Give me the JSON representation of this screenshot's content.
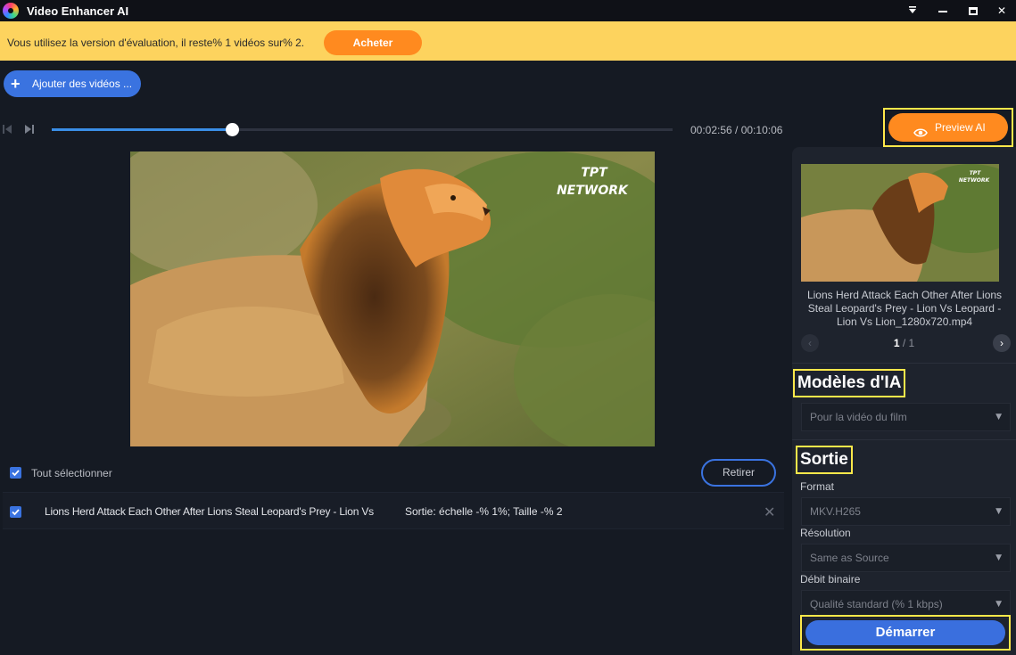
{
  "app": {
    "title": "Video Enhancer AI",
    "icons": [
      "app-logo-icon",
      "dropdown-menu-icon",
      "minimize-icon",
      "maximize-icon",
      "close-icon"
    ]
  },
  "banner": {
    "text": "Vous utilisez la version d'évaluation, il reste% 1 vidéos sur% 2.",
    "buy_label": "Acheter"
  },
  "toolbar": {
    "add_videos_label": "Ajouter des vidéos ..."
  },
  "player": {
    "time": "00:02:56 / 00:10:06",
    "progress": 0.29,
    "watermark": "TPT NETWORK",
    "preview_label": "Preview AI"
  },
  "list": {
    "select_all_label": "Tout sélectionner",
    "remove_label": "Retirer",
    "rows": [
      {
        "name": "Lions Herd Attack Each Other After Lions Steal Leopard's Prey - Lion Vs",
        "output": "Sortie: échelle -% 1%; Taille -% 2"
      }
    ]
  },
  "panel": {
    "thumbnail_title": "Lions Herd Attack Each Other After Lions Steal Leopard's Prey - Lion Vs Leopard - Lion Vs Lion_1280x720.mp4",
    "pager_current": "1",
    "pager_total": " / 1",
    "models_heading": "Modèles d'IA",
    "model_value": "Pour la vidéo du film",
    "output_heading": "Sortie",
    "format_label": "Format",
    "format_value": "MKV.H265",
    "resolution_label": "Résolution",
    "resolution_value": "Same as Source",
    "bitrate_label": "Débit binaire",
    "bitrate_value": "Qualité standard (% 1 kbps)",
    "start_label": "Démarrer"
  },
  "colors": {
    "accent_blue": "#3a73e0",
    "accent_orange": "#ff8a1f",
    "banner_yellow": "#fdd35e",
    "highlight_yellow": "#ffe84a"
  }
}
